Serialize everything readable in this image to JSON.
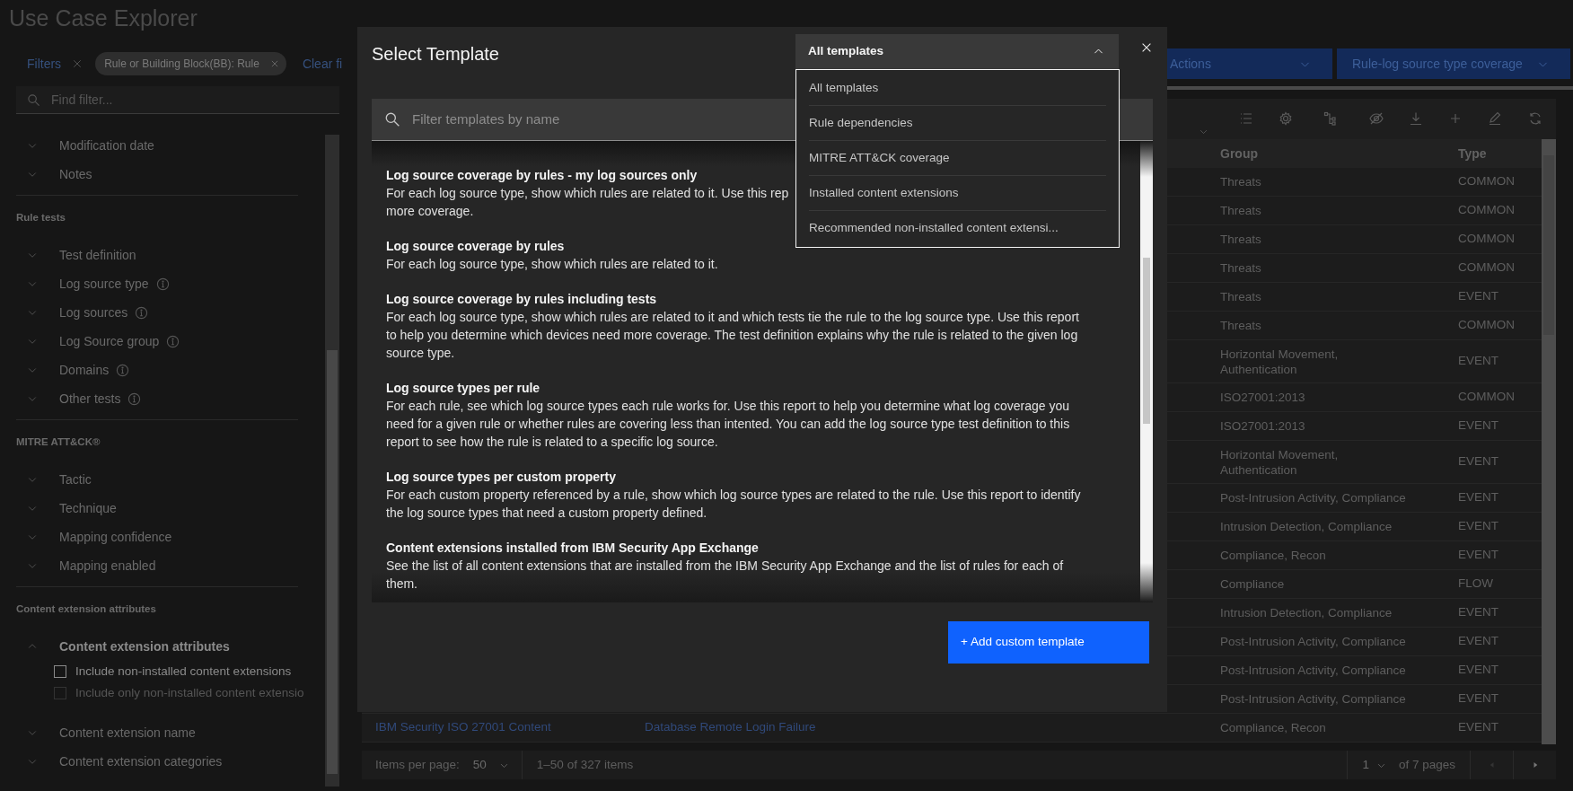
{
  "page": {
    "title": "Use Case Explorer"
  },
  "filters": {
    "label": "Filters",
    "tag": "Rule or Building Block(BB): Rule",
    "clear": "Clear fi"
  },
  "sidebar": {
    "search_placeholder": "Find filter...",
    "sections": [
      {
        "items": [
          {
            "label": "Modification date",
            "expanded": false
          },
          {
            "label": "Notes",
            "expanded": false
          }
        ]
      },
      {
        "heading": "Rule tests",
        "items": [
          {
            "label": "Test definition",
            "expanded": false
          },
          {
            "label": "Log source type",
            "expanded": false,
            "info": true
          },
          {
            "label": "Log sources",
            "expanded": false,
            "info": true
          },
          {
            "label": "Log Source group",
            "expanded": false,
            "info": true
          },
          {
            "label": "Domains",
            "expanded": false,
            "info": true
          },
          {
            "label": "Other tests",
            "expanded": false,
            "info": true
          }
        ]
      },
      {
        "heading": "MITRE ATT&CK®",
        "items": [
          {
            "label": "Tactic",
            "expanded": false
          },
          {
            "label": "Technique",
            "expanded": false
          },
          {
            "label": "Mapping confidence",
            "expanded": false
          },
          {
            "label": "Mapping enabled",
            "expanded": false
          }
        ]
      },
      {
        "heading": "Content extension attributes",
        "items": [
          {
            "label": "Content extension attributes",
            "expanded": true,
            "children": [
              {
                "label": "Include non-installed content extensions",
                "checked": false,
                "disabled": false
              },
              {
                "label": "Include only non-installed content extensio",
                "checked": false,
                "disabled": true
              }
            ]
          },
          {
            "label": "Content extension name",
            "expanded": false
          },
          {
            "label": "Content extension categories",
            "expanded": false
          }
        ]
      }
    ]
  },
  "actions": [
    "Actions",
    "Rule-log source type coverage"
  ],
  "table": {
    "columns": [
      "Group",
      "Type"
    ],
    "rows": [
      {
        "group": "Threats",
        "type": "COMMON"
      },
      {
        "group": "Threats",
        "type": "COMMON"
      },
      {
        "group": "Threats",
        "type": "COMMON"
      },
      {
        "group": "Threats",
        "type": "COMMON"
      },
      {
        "group": "Threats",
        "type": "EVENT"
      },
      {
        "group": "Threats",
        "type": "COMMON"
      },
      {
        "group": "Horizontal Movement,\nAuthentication",
        "type": "EVENT"
      },
      {
        "group": "ISO27001:2013",
        "type": "COMMON"
      },
      {
        "group": "ISO27001:2013",
        "type": "EVENT"
      },
      {
        "group": "Horizontal Movement,\nAuthentication",
        "type": "EVENT"
      },
      {
        "group": "Post-Intrusion Activity, Compliance",
        "type": "EVENT"
      },
      {
        "group": "Intrusion Detection, Compliance",
        "type": "EVENT"
      },
      {
        "group": "Compliance, Recon",
        "type": "EVENT"
      },
      {
        "group": "Compliance",
        "type": "FLOW"
      },
      {
        "group": "Intrusion Detection, Compliance",
        "type": "EVENT"
      },
      {
        "group": "Post-Intrusion Activity, Compliance",
        "type": "EVENT"
      },
      {
        "group": "Post-Intrusion Activity, Compliance",
        "type": "EVENT"
      },
      {
        "group": "Post-Intrusion Activity, Compliance",
        "type": "EVENT"
      },
      {
        "content_extension": "IBM Security ISO 27001 Content",
        "rule": "Database Remote Login Failure",
        "group": "Compliance, Recon",
        "type": "EVENT"
      }
    ]
  },
  "pagination": {
    "items_per_page_label": "Items per page:",
    "items_per_page": "50",
    "range": "1–50 of 327 items",
    "page": "1",
    "page_count": "of 7 pages"
  },
  "modal": {
    "title": "Select Template",
    "dropdown": {
      "value": "All templates",
      "expanded": true,
      "options": [
        "All templates",
        "Rule dependencies",
        "MITRE ATT&CK coverage",
        "Installed content extensions",
        "Recommended non-installed content extensi..."
      ]
    },
    "search_placeholder": "Filter templates by name",
    "templates": [
      {
        "title": "Log source coverage by rules - my log sources only",
        "lines": [
          "For each log source type, show which rules are related to it. Use this rep",
          "more coverage."
        ]
      },
      {
        "title": "Log source coverage by rules",
        "lines": [
          "For each log source type, show which rules are related to it."
        ]
      },
      {
        "title": "Log source coverage by rules including tests",
        "lines": [
          "For each log source type, show which rules are related to it and which tests tie the rule to the log source type. Use this report",
          "to help you determine which devices need more coverage. The test definition explains why the rule is related to the given log",
          "source type."
        ]
      },
      {
        "title": "Log source types per rule",
        "lines": [
          "For each rule, see which log source types each rule works for. Use this report to help you determine what log coverage you",
          "need for a given rule or whether rules are covering less than intented. You can add the log source type test definition to this",
          "report to see how the rule is related to a specific log source."
        ]
      },
      {
        "title": "Log source types per custom property",
        "lines": [
          "For each custom property referenced by a rule, show which log source types are related to the rule. Use this report to identify",
          "the log source types that need a custom property defined."
        ]
      },
      {
        "title": "Content extensions installed from IBM Security App Exchange",
        "lines": [
          "See the list of all content extensions that are installed from the IBM Security App Exchange and the list of rules for each of",
          "them."
        ]
      }
    ],
    "button": "+ Add custom template"
  }
}
